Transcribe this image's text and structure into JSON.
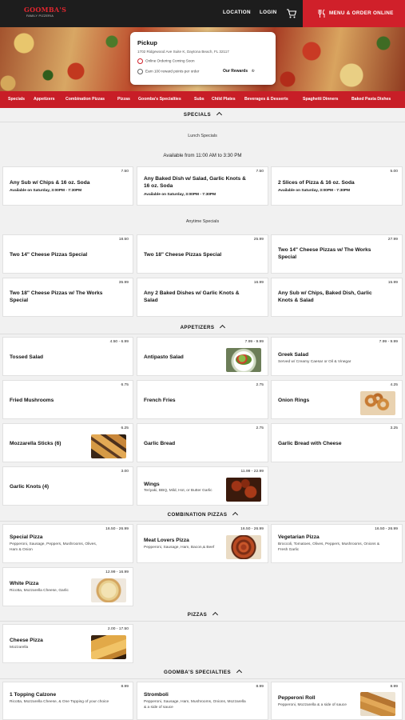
{
  "header": {
    "logo_top": "GOOMBA'S",
    "logo_bottom": "FAMILY PIZZERIA",
    "location_label": "LOCATION",
    "login_label": "LOGIN",
    "order_label": "MENU & ORDER ONLINE"
  },
  "pickup": {
    "title": "Pickup",
    "address": "1702 Ridgewood Ave Suite K, Daytona Beach, FL 32117",
    "notice": "Online Ordering Coming Soon",
    "reward_note": "Earn 100 reward points per order",
    "rewards_label": "Our Rewards"
  },
  "categories": [
    "Specials",
    "Appetizers",
    "Combination Pizzas",
    "Pizzas",
    "Goomba's Specialties",
    "Subs",
    "Child Plates",
    "Beverages & Desserts",
    "Spaghetti Dinners",
    "Baked Pasta Dishes"
  ],
  "specials": {
    "heading": "SPECIALS",
    "lunch_label": "Lunch Specials",
    "lunch_hours": "Available from 11:00 AM to 3:30 PM",
    "lunch_items": [
      {
        "name": "Any Sub w/ Chips & 16 oz. Soda",
        "price": "7.50",
        "desc": "Available on Saturday, 3:00PM - 7:30PM"
      },
      {
        "name": "Any Baked Dish w/ Salad, Garlic Knots & 16 oz. Soda",
        "price": "7.50",
        "desc": "Available on Saturday, 3:00PM - 7:30PM"
      },
      {
        "name": "2 Slices of Pizza & 16 oz. Soda",
        "price": "5.00",
        "desc": "Available on Saturday, 3:00PM - 7:30PM"
      }
    ],
    "anytime_label": "Anytime Specials",
    "anytime_items": [
      {
        "name": "Two 14\" Cheese Pizzas Special",
        "price": "18.50"
      },
      {
        "name": "Two 18\" Cheese Pizzas Special",
        "price": "25.99"
      },
      {
        "name": "Two 14\" Cheese Pizzas w/ The Works Special",
        "price": "27.99"
      },
      {
        "name": "Two 18\" Cheese Pizzas w/ The Works Special",
        "price": "35.99"
      },
      {
        "name": "Any 2 Baked Dishes w/ Garlic Knots & Salad",
        "price": "16.99"
      },
      {
        "name": "Any Sub w/ Chips, Baked Dish, Garlic Knots & Salad",
        "price": "15.99"
      }
    ]
  },
  "appetizers": {
    "heading": "APPETIZERS",
    "items": [
      {
        "name": "Tossed Salad",
        "price": "4.50 - 6.99"
      },
      {
        "name": "Antipasto Salad",
        "price": "7.99 - 9.99"
      },
      {
        "name": "Greek Salad",
        "price": "7.99 - 9.99",
        "desc": "Served w/ Creamy Caesar or Oil & Vinegar"
      },
      {
        "name": "Fried Mushrooms",
        "price": "6.75"
      },
      {
        "name": "French Fries",
        "price": "2.75"
      },
      {
        "name": "Onion Rings",
        "price": "4.25"
      },
      {
        "name": "Mozzarella Sticks (6)",
        "price": "6.25"
      },
      {
        "name": "Garlic Bread",
        "price": "2.75"
      },
      {
        "name": "Garlic Bread with Cheese",
        "price": "3.25"
      },
      {
        "name": "Garlic Knots (4)",
        "price": "3.00"
      },
      {
        "name": "Wings",
        "price": "11.99 - 22.99",
        "desc": "Teriyaki, BBQ, Mild, Hot, or Butter Garlic"
      }
    ]
  },
  "combination_pizzas": {
    "heading": "COMBINATION PIZZAS",
    "items": [
      {
        "name": "Special Pizza",
        "price": "16.50 - 26.99",
        "desc": "Pepperoni, Sausage, Peppers, Mushrooms, Olives, Ham & Onion"
      },
      {
        "name": "Meat Lovers Pizza",
        "price": "16.50 - 26.99",
        "desc": "Pepperoni, Sausage, Ham, Bacon,& Beef"
      },
      {
        "name": "Vegetarian Pizza",
        "price": "16.50 - 26.99",
        "desc": "Broccoli, Tomatoes, Olives, Peppers, Mushrooms, Onions & Fresh Garlic"
      },
      {
        "name": "White Pizza",
        "price": "12.99 - 16.99",
        "desc": "Ricotta, Mozzarella Cheese, Garlic"
      }
    ]
  },
  "pizzas": {
    "heading": "PIZZAS",
    "items": [
      {
        "name": "Cheese Pizza",
        "price": "2.00 - 17.50",
        "desc": "Mozzarella"
      }
    ]
  },
  "specialties": {
    "heading": "GOOMBA'S SPECIALTIES",
    "items": [
      {
        "name": "1 Topping Calzone",
        "price": "8.99",
        "desc": "Ricotta, Mozzarella Cheese, & One Topping of your choice"
      },
      {
        "name": "Stromboli",
        "price": "8.99",
        "desc": "Pepperoni, Sausage, Ham, Mushrooms, Onions, Mozzarella & a side of sauce"
      },
      {
        "name": "Pepperoni Roll",
        "price": "8.99",
        "desc": "Pepperoni, Mozzarella & a side of sauce"
      }
    ]
  },
  "colors": {
    "brand_red": "#d0202a",
    "header_bg": "#1d1d1d",
    "page_bg": "#f1f1f1"
  }
}
